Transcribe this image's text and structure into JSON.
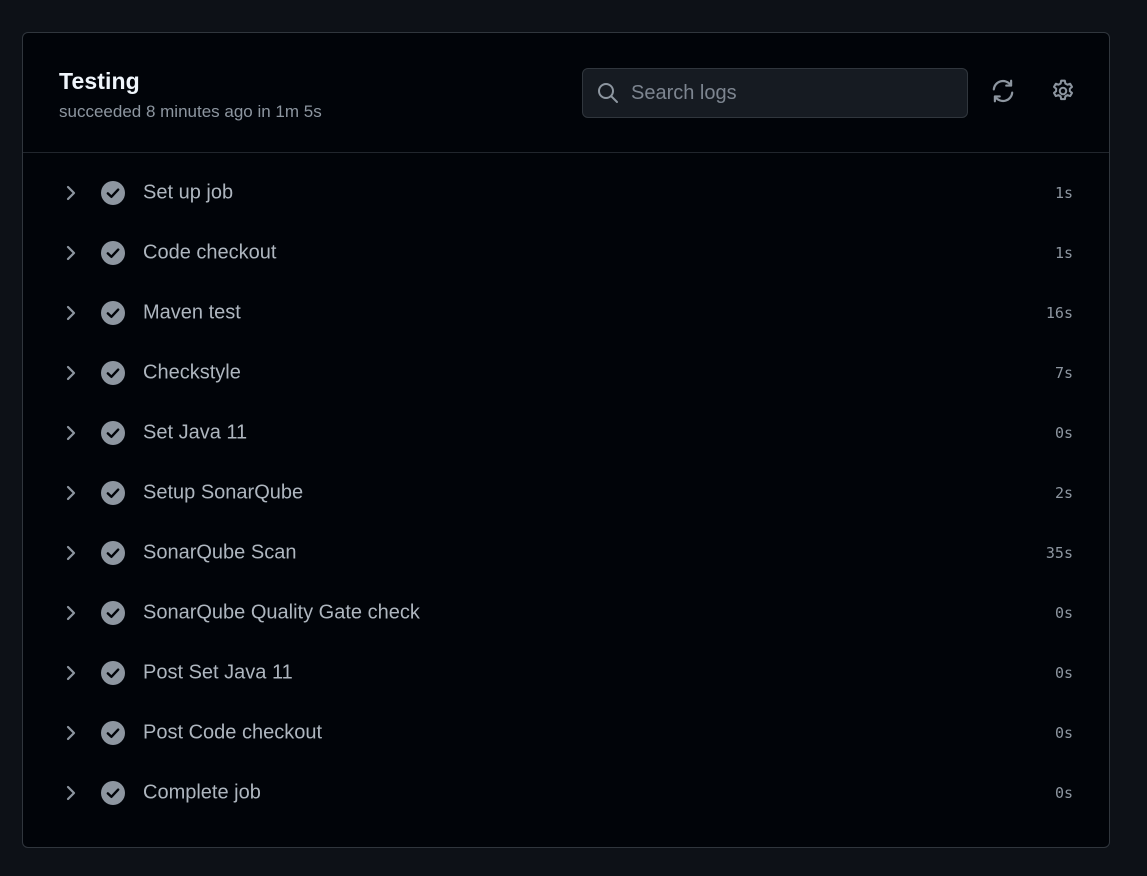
{
  "job": {
    "title": "Testing",
    "subtitle": "succeeded 8 minutes ago in 1m 5s"
  },
  "search": {
    "placeholder": "Search logs",
    "icon": "search-icon"
  },
  "actions": {
    "refresh_icon": "refresh-icon",
    "settings_icon": "gear-icon"
  },
  "colors": {
    "page_bg": "#0d1117",
    "panel_bg": "#010409",
    "step_check": "#8d96a0",
    "muted_text": "#8d96a0"
  },
  "steps": [
    {
      "name": "Set up job",
      "duration": "1s",
      "status": "success"
    },
    {
      "name": "Code checkout",
      "duration": "1s",
      "status": "success"
    },
    {
      "name": "Maven test",
      "duration": "16s",
      "status": "success"
    },
    {
      "name": "Checkstyle",
      "duration": "7s",
      "status": "success"
    },
    {
      "name": "Set Java 11",
      "duration": "0s",
      "status": "success"
    },
    {
      "name": "Setup SonarQube",
      "duration": "2s",
      "status": "success"
    },
    {
      "name": "SonarQube Scan",
      "duration": "35s",
      "status": "success"
    },
    {
      "name": "SonarQube Quality Gate check",
      "duration": "0s",
      "status": "success"
    },
    {
      "name": "Post Set Java 11",
      "duration": "0s",
      "status": "success"
    },
    {
      "name": "Post Code checkout",
      "duration": "0s",
      "status": "success"
    },
    {
      "name": "Complete job",
      "duration": "0s",
      "status": "success"
    }
  ]
}
